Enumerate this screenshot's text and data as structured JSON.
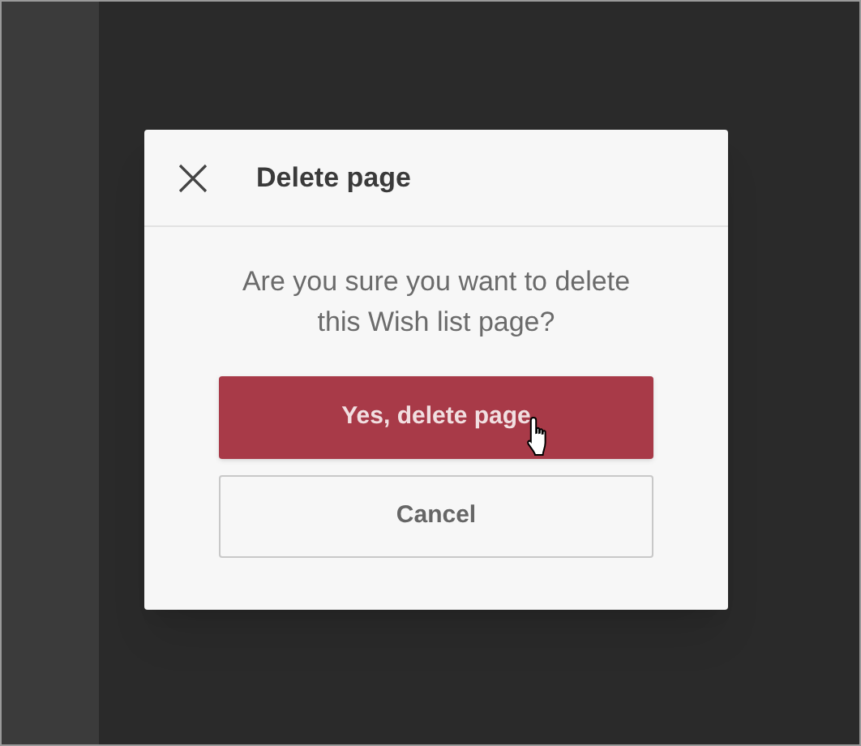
{
  "dialog": {
    "title": "Delete page",
    "message": "Are you sure you want to delete this Wish list page?",
    "buttons": [
      {
        "label": "Yes, delete page",
        "kind": "primary",
        "hovered": true
      },
      {
        "label": "Cancel",
        "kind": "secondary",
        "hovered": false
      }
    ]
  }
}
